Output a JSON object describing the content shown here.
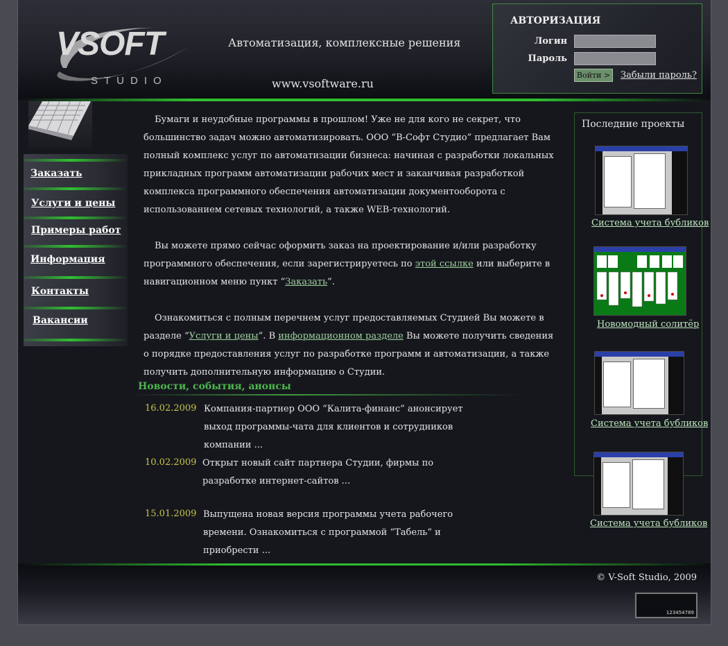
{
  "header": {
    "logo_main": "VSOFT",
    "logo_sub": "STUDIO",
    "slogan": "Автоматизация, комплексные решения",
    "site_url": "www.vsoftware.ru"
  },
  "auth": {
    "title": "АВТОРИЗАЦИЯ",
    "login_label": "Логин",
    "password_label": "Пароль",
    "login_value": "",
    "password_value": "",
    "submit_label": "Войти >",
    "forgot_label": "Забыли пароль?"
  },
  "nav": {
    "items": [
      {
        "label": "Заказать"
      },
      {
        "label": "Услуги и цены"
      },
      {
        "label": "Примеры работ"
      },
      {
        "label": "Информация"
      },
      {
        "label": "Контакты"
      },
      {
        "label": "Вакансии"
      }
    ]
  },
  "intro": {
    "p1": "Бумаги и неудобные программы в прошлом! Уже не для кого не секрет, что большинство задач можно автоматизировать. ООО “В-Софт Студио” предлагает Вам полный комплекс услуг по автоматизации бизнеса: начиная с разработки локальных прикладных программ автоматизации рабочих мест и заканчивая разработкой комплекса программного обеспечения автоматизации документооборота с использованием сетевых технологий, а также WEB-технологий.",
    "p2_before": "Вы можете прямо сейчас оформить заказ на проектирование и/или разработку программного обеспечения, если зарегистрируетесь по ",
    "p2_link1": "этой ссылке",
    "p2_middle": " или выберите в навигационном меню пункт “",
    "p2_link2": "Заказать",
    "p2_after": "”.",
    "p3_before": "Ознакомиться с полным перечнем услуг предоставляемых Студией Вы можете в разделе “",
    "p3_link1": "Услуги и цены",
    "p3_middle": "”. В ",
    "p3_link2": "информационном разделе",
    "p3_after": " Вы можете получить сведения о порядке предоставления услуг по разработке программ и автоматизации, а также получить дополнительную информацию о Студии."
  },
  "news": {
    "title": "Новости, события, анонсы",
    "items": [
      {
        "date": "16.02.2009",
        "text": "Компания-партнер ООО “Калита-финанс” анонсирует выход программы-чата для клиентов и сотрудников компании ..."
      },
      {
        "date": "10.02.2009",
        "text": "Открыт новый сайт партнера Студии, фирмы по разработке интернет-сайтов ..."
      },
      {
        "date": "15.01.2009",
        "text": "Выпущена новая версия программы учета рабочего времени. Ознакомиться с программой “Табель” и приобрести ..."
      }
    ]
  },
  "projects": {
    "title": "Последние проекты",
    "items": [
      {
        "caption": "Система учета бубликов"
      },
      {
        "caption": "Новомодный солитёр"
      },
      {
        "caption": "Система учета бубликов"
      },
      {
        "caption": "Система учета бубликов"
      }
    ]
  },
  "footer": {
    "copyright": "© V-Soft Studio, 2009",
    "counter": "123454789"
  },
  "colors": {
    "accent_green": "#2fbd2f",
    "news_title": "#4db64d",
    "date": "#c9c64a",
    "link": "#9fd29f"
  }
}
